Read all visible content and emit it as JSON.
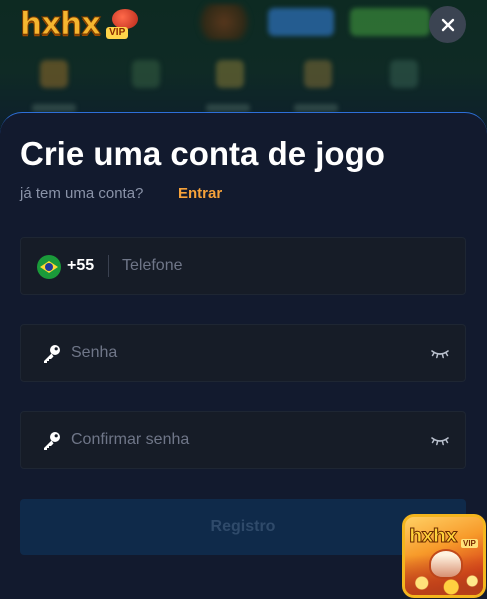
{
  "header": {
    "logo_text": "hxhx",
    "logo_badge": "VIP",
    "close_label": "×"
  },
  "modal": {
    "title": "Crie uma conta de jogo",
    "subtitle": "já tem uma conta?",
    "login_link": "Entrar",
    "phone": {
      "country_icon": "brazil-flag-icon",
      "dial_code": "+55",
      "placeholder": "Telefone",
      "value": ""
    },
    "password": {
      "icon": "key-icon",
      "placeholder": "Senha",
      "value": "",
      "toggle_icon": "eye-closed-icon"
    },
    "confirm_password": {
      "icon": "key-icon",
      "placeholder": "Confirmar senha",
      "value": "",
      "toggle_icon": "eye-closed-icon"
    },
    "register_label": "Registro"
  },
  "app_icon": {
    "logo_text": "hxhx",
    "badge": "VIP"
  },
  "colors": {
    "accent_link": "#f6a23a",
    "modal_bg": "#121a2e",
    "modal_border": "#2d6fd8",
    "field_bg": "#161c27",
    "register_bg": "#0f2a4a",
    "logo_gold": "#f5b630"
  }
}
